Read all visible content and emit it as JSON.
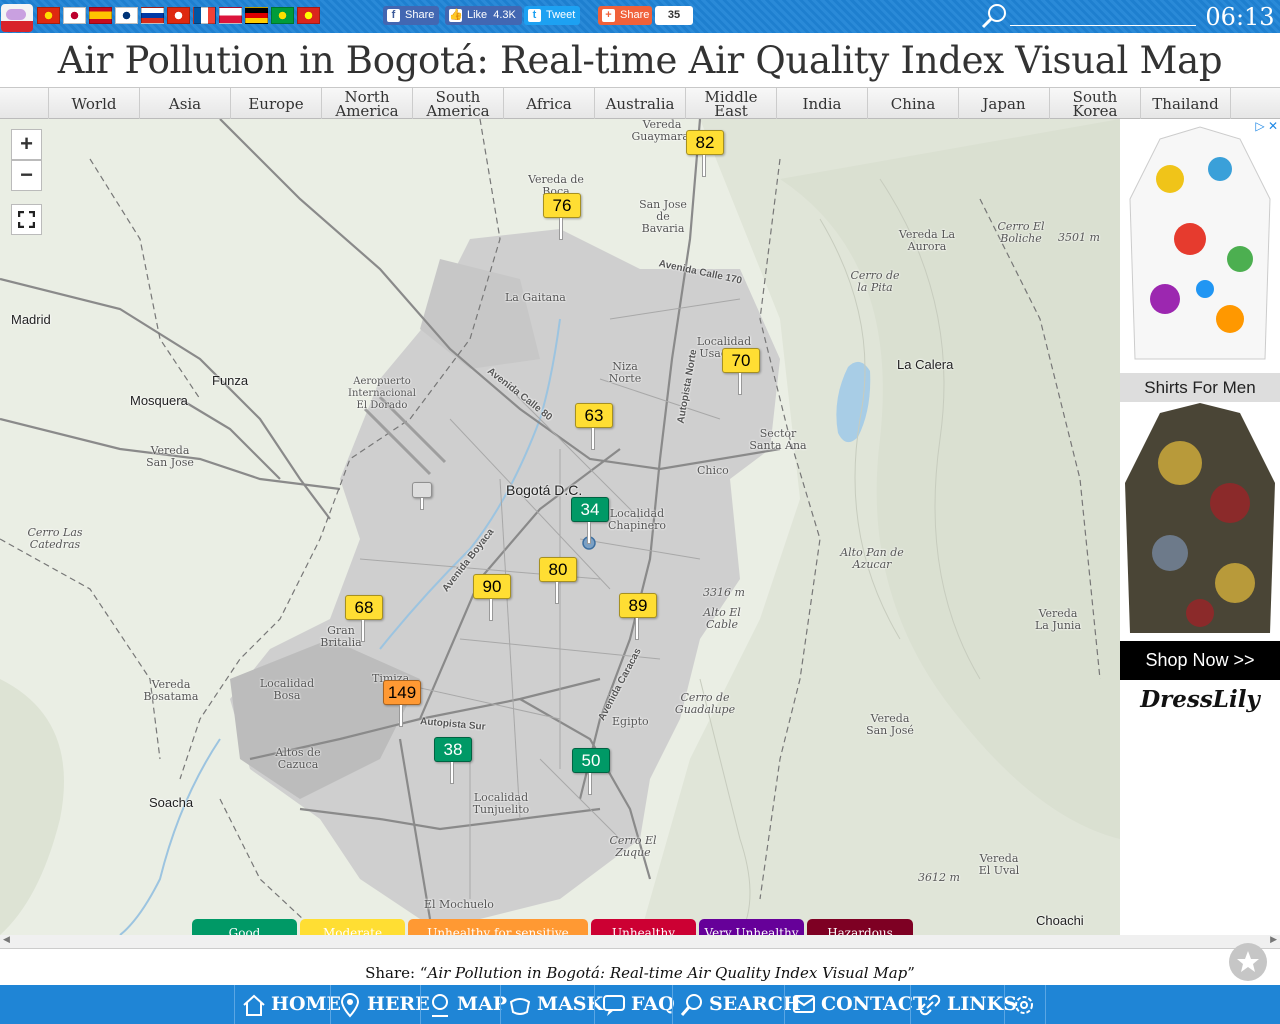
{
  "header": {
    "flags": [
      {
        "name": "china-flag",
        "colors": [
          "#de2910",
          "#ffde00"
        ]
      },
      {
        "name": "japan-flag",
        "colors": [
          "#ffffff",
          "#bc002d"
        ]
      },
      {
        "name": "spain-flag",
        "colors": [
          "#c60b1e",
          "#ffc400"
        ]
      },
      {
        "name": "korea-flag",
        "colors": [
          "#ffffff",
          "#003478"
        ]
      },
      {
        "name": "russia-flag",
        "colors": [
          "#ffffff",
          "#0039a6",
          "#d52b1e"
        ]
      },
      {
        "name": "hong-kong-flag",
        "colors": [
          "#de2910",
          "#ffffff"
        ]
      },
      {
        "name": "france-flag",
        "colors": [
          "#0055a4",
          "#ffffff",
          "#ef4135"
        ]
      },
      {
        "name": "poland-flag",
        "colors": [
          "#ffffff",
          "#dc143c"
        ]
      },
      {
        "name": "germany-flag",
        "colors": [
          "#000000",
          "#dd0000",
          "#ffce00"
        ]
      },
      {
        "name": "brazil-flag",
        "colors": [
          "#009c3b",
          "#ffdf00"
        ]
      },
      {
        "name": "vietnam-flag",
        "colors": [
          "#da251d",
          "#ffff00"
        ]
      }
    ],
    "social": {
      "share": "Share",
      "like": "Like",
      "like_count": "4.3K",
      "tweet": "Tweet",
      "share2": "Share",
      "share_count": "35"
    },
    "search_value": "",
    "clock": "06:13"
  },
  "title": "Air Pollution in Bogotá: Real-time Air Quality Index Visual Map",
  "regions": [
    "World",
    "Asia",
    "Europe",
    "North America",
    "South America",
    "Africa",
    "Australia",
    "Middle East",
    "India",
    "China",
    "Japan",
    "South Korea",
    "Thailand"
  ],
  "map": {
    "zoom_in": "+",
    "zoom_out": "−",
    "labels": {
      "madrid": "Madrid",
      "funza": "Funza",
      "mosquera": "Mosquera",
      "bogota": "Bogotá D.C.",
      "la_calera": "La Calera",
      "soacha": "Soacha",
      "chico": "Chico",
      "choachi": "Choachi",
      "la_gaitana": "La Gaitana",
      "vereda_guaymaral": "Vereda Guaymaral",
      "vereda_de_boca": "Vereda de Boca",
      "san_jose_bavaria": "San Jose de Bavaria",
      "vereda_la_aurora": "Vereda La Aurora",
      "cerro_el_boliche": "Cerro El Boliche",
      "elev_3501": "3501 m",
      "cerro_la_pita": "Cerro de la Pita",
      "localidad_usaquen": "Localidad Usaquen",
      "niza_norte": "Niza Norte",
      "aeropuerto": "Aeropuerto Internacional El Dorado",
      "vereda_san_jose": "Vereda San Jose",
      "cerro_las_catedras": "Cerro Las Catedras",
      "sector_santa_ana": "Sector Santa Ana",
      "localidad_chapinero": "Localidad Chapinero",
      "alto_pan_de_azucar": "Alto Pan de Azucar",
      "elev_3316": "3316 m",
      "alto_el_cable": "Alto El Cable",
      "gran_britalia": "Gran Britalia",
      "localidad_bosa": "Localidad Bosa",
      "timiza": "Timiza",
      "vereda_bosatama": "Vereda Bosatama",
      "altos_de_cazuca": "Altos de Cazuca",
      "localidad_tunjuelito": "Localidad Tunjuelito",
      "cerro_guadalupe": "Cerro de Guadalupe",
      "egipto": "Egipto",
      "vereda_san_jose_east": "Vereda San José",
      "vereda_la_junia": "Vereda La Junia",
      "cerro_el_zuque": "Cerro El Zuque",
      "vereda_el_uval": "Vereda El Uval",
      "elev_3612": "3612 m",
      "el_mochuelo": "El Mochuelo",
      "road_calle80": "Avenida Calle 80",
      "road_boyaca": "Avenida Boyaca",
      "road_caracas": "Avenida Caracas",
      "road_autopista_sur": "Autopista Sur",
      "road_calle170": "Avenida Calle 170",
      "road_autopista_norte": "Autopista Norte"
    },
    "stations": [
      {
        "aqi": 82,
        "color": "#ffde33",
        "text": "#000000"
      },
      {
        "aqi": 76,
        "color": "#ffde33",
        "text": "#000000"
      },
      {
        "aqi": 70,
        "color": "#ffde33",
        "text": "#000000"
      },
      {
        "aqi": 63,
        "color": "#ffde33",
        "text": "#000000"
      },
      {
        "aqi": 34,
        "color": "#009966",
        "text": "#ffffff"
      },
      {
        "aqi": 80,
        "color": "#ffde33",
        "text": "#000000"
      },
      {
        "aqi": 90,
        "color": "#ffde33",
        "text": "#000000"
      },
      {
        "aqi": 89,
        "color": "#ffde33",
        "text": "#000000"
      },
      {
        "aqi": 68,
        "color": "#ffde33",
        "text": "#000000"
      },
      {
        "aqi": 149,
        "color": "#ff9933",
        "text": "#000000"
      },
      {
        "aqi": 38,
        "color": "#009966",
        "text": "#ffffff"
      },
      {
        "aqi": 50,
        "color": "#009966",
        "text": "#ffffff"
      }
    ],
    "legend": [
      {
        "label": "Good",
        "color": "#009966"
      },
      {
        "label": "Moderate",
        "color": "#ffde33"
      },
      {
        "label": "Unhealthy for sensitive groups",
        "color": "#ff9933"
      },
      {
        "label": "Unhealthy",
        "color": "#cc0033"
      },
      {
        "label": "Very Unhealthy",
        "color": "#660099"
      },
      {
        "label": "Hazardous",
        "color": "#7e0023"
      }
    ]
  },
  "ad": {
    "text": "Shirts For Men",
    "cta": "Shop Now >>",
    "brand": "DressLily"
  },
  "share_line": {
    "prefix": "Share: “",
    "title": "Air Pollution in Bogotá: Real-time Air Quality Index Visual Map",
    "suffix": "”"
  },
  "bottom_nav": [
    {
      "label": "HOME",
      "icon": "home-icon"
    },
    {
      "label": "HERE",
      "icon": "location-pin-icon"
    },
    {
      "label": "MAP",
      "icon": "map-icon"
    },
    {
      "label": "MASK",
      "icon": "mask-icon"
    },
    {
      "label": "FAQ",
      "icon": "faq-icon"
    },
    {
      "label": "SEARCH",
      "icon": "search-icon"
    },
    {
      "label": "CONTACT",
      "icon": "contact-icon"
    },
    {
      "label": "LINKS",
      "icon": "link-icon"
    },
    {
      "label": "",
      "icon": "gear-icon"
    }
  ]
}
